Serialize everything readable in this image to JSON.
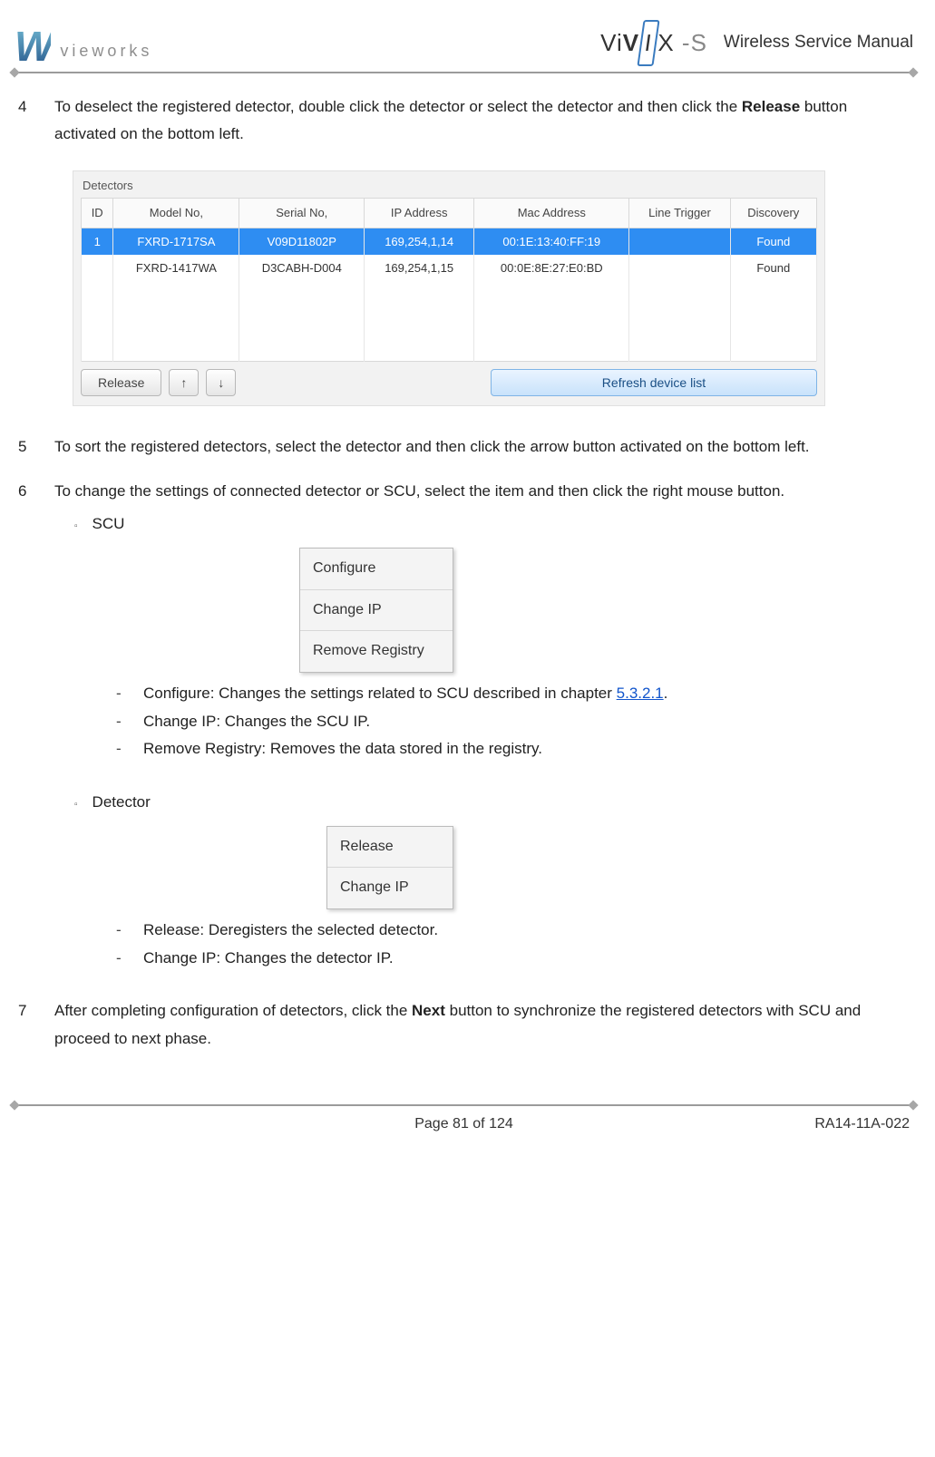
{
  "header": {
    "brand_mark": "W",
    "brand_text": "vieworks",
    "product_logo": "ViVIX -S",
    "manual_title": "Wireless Service Manual"
  },
  "steps": {
    "s4": {
      "num": "4",
      "text_a": "To deselect the registered detector, double click the detector or select the detector and then click the ",
      "bold": "Release",
      "text_b": " button activated on the bottom left."
    },
    "s5": {
      "num": "5",
      "text": "To sort the registered detectors, select the detector and then click the arrow button activated on the bottom left."
    },
    "s6": {
      "num": "6",
      "text": "To change the settings of connected detector or SCU, select the item and then click the right mouse button.",
      "sub1_label": "SCU",
      "sub1_items": {
        "i1_a": "Configure: Changes the settings related to SCU described in chapter ",
        "i1_link": "5.3.2.1",
        "i1_b": ".",
        "i2": "Change IP: Changes the SCU IP.",
        "i3": "Remove Registry: Removes the data stored in the registry."
      },
      "sub2_label": "Detector",
      "sub2_items": {
        "i1": "Release: Deregisters the selected detector.",
        "i2": "Change IP: Changes the detector IP."
      }
    },
    "s7": {
      "num": "7",
      "text_a": "After completing configuration of detectors, click the ",
      "bold": "Next",
      "text_b": " button to synchronize the registered detectors with SCU and proceed to next phase."
    }
  },
  "detectors_panel": {
    "label": "Detectors",
    "cols": {
      "c1": "ID",
      "c2": "Model No,",
      "c3": "Serial No,",
      "c4": "IP Address",
      "c5": "Mac Address",
      "c6": "Line Trigger",
      "c7": "Discovery"
    },
    "row1": {
      "id": "1",
      "model": "FXRD-1717SA",
      "serial": "V09D11802P",
      "ip": "169,254,1,14",
      "mac": "00:1E:13:40:FF:19",
      "trig": "",
      "disc": "Found"
    },
    "row2": {
      "id": "",
      "model": "FXRD-1417WA",
      "serial": "D3CABH-D004",
      "ip": "169,254,1,15",
      "mac": "00:0E:8E:27:E0:BD",
      "trig": "",
      "disc": "Found"
    },
    "buttons": {
      "release": "Release",
      "up": "↑",
      "down": "↓",
      "refresh": "Refresh device list"
    }
  },
  "scu_menu": {
    "m1": "Configure",
    "m2": "Change IP",
    "m3": "Remove Registry"
  },
  "det_menu": {
    "m1": "Release",
    "m2": "Change IP"
  },
  "footer": {
    "page": "Page 81 of 124",
    "doc": "RA14-11A-022"
  }
}
